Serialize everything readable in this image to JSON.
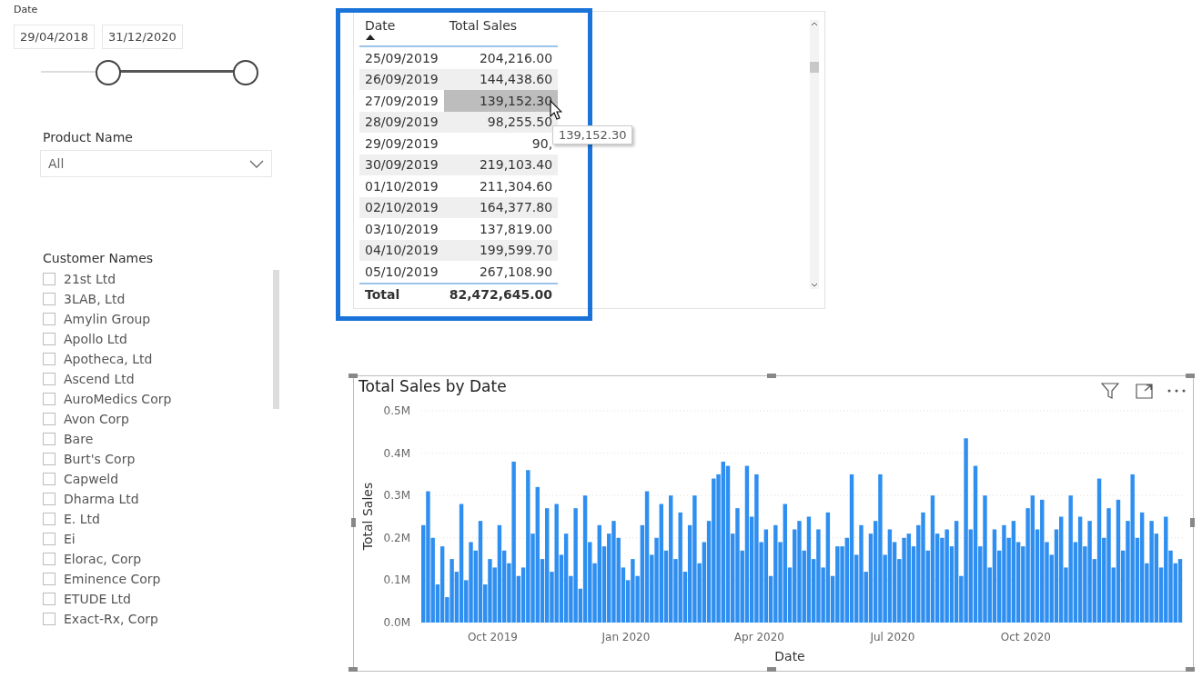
{
  "date_slicer": {
    "title": "Date",
    "start": "29/04/2018",
    "end": "31/12/2020",
    "thumbs": [
      {
        "level": 0.33
      },
      {
        "level": 1
      }
    ]
  },
  "product_slicer": {
    "title": "Product Name",
    "value": "All"
  },
  "customer_slicer": {
    "title": "Customer Names",
    "items": [
      {
        "label": "21st Ltd",
        "checked": false
      },
      {
        "label": "3LAB, Ltd",
        "checked": false
      },
      {
        "label": "Amylin Group",
        "checked": false
      },
      {
        "label": "Apollo Ltd",
        "checked": false
      },
      {
        "label": "Apotheca, Ltd",
        "checked": false
      },
      {
        "label": "Ascend Ltd",
        "checked": false
      },
      {
        "label": "AuroMedics Corp",
        "checked": false
      },
      {
        "label": "Avon Corp",
        "checked": false
      },
      {
        "label": "Bare",
        "checked": false
      },
      {
        "label": "Burt's Corp",
        "checked": false
      },
      {
        "label": "Capweld",
        "checked": false
      },
      {
        "label": "Dharma Ltd",
        "checked": false
      },
      {
        "label": "E. Ltd",
        "checked": false
      },
      {
        "label": "Ei",
        "checked": false
      },
      {
        "label": "Elorac, Corp",
        "checked": false
      },
      {
        "label": "Eminence Corp",
        "checked": false
      },
      {
        "label": "ETUDE Ltd",
        "checked": false
      },
      {
        "label": "Exact-Rx, Corp",
        "checked": false
      }
    ]
  },
  "table": {
    "columns": [
      "Date",
      "Total Sales"
    ],
    "rows": [
      {
        "date": "25/09/2019",
        "sales": "204,216.00",
        "selected": false
      },
      {
        "date": "26/09/2019",
        "sales": "144,438.60",
        "selected": false
      },
      {
        "date": "27/09/2019",
        "sales": "139,152.30",
        "selected": true
      },
      {
        "date": "28/09/2019",
        "sales": "98,255.50",
        "selected": false
      },
      {
        "date": "29/09/2019",
        "sales": "90,",
        "selected": false
      },
      {
        "date": "30/09/2019",
        "sales": "219,103.40",
        "selected": false
      },
      {
        "date": "01/10/2019",
        "sales": "211,304.60",
        "selected": false
      },
      {
        "date": "02/10/2019",
        "sales": "164,377.80",
        "selected": false
      },
      {
        "date": "03/10/2019",
        "sales": "137,819.00",
        "selected": false
      },
      {
        "date": "04/10/2019",
        "sales": "199,599.70",
        "selected": false
      },
      {
        "date": "05/10/2019",
        "sales": "267,108.90",
        "selected": false
      }
    ],
    "total_label": "Total",
    "total_value": "82,472,645.00",
    "tooltip": "139,152.30"
  },
  "chart": {
    "title": "Total Sales by Date",
    "chart_data": {
      "type": "bar",
      "grid": true,
      "xlabel": "Date",
      "ylabel": "Total Sales",
      "ylim": [
        0,
        500000
      ],
      "yticks": [
        {
          "value": 0,
          "label": "0.0M"
        },
        {
          "value": 100000,
          "label": "0.1M"
        },
        {
          "value": 200000,
          "label": "0.2M"
        },
        {
          "value": 300000,
          "label": "0.3M"
        },
        {
          "value": 400000,
          "label": "0.4M"
        },
        {
          "value": 500000,
          "label": "0.5M"
        }
      ],
      "categories": [
        null,
        null,
        null,
        null,
        null,
        null,
        null,
        null,
        null,
        null,
        null,
        null,
        null,
        null,
        null,
        "Oct 2019",
        null,
        null,
        null,
        null,
        null,
        null,
        null,
        null,
        null,
        null,
        null,
        null,
        null,
        null,
        null,
        null,
        null,
        null,
        null,
        null,
        null,
        null,
        null,
        null,
        null,
        null,
        null,
        "Jan 2020",
        null,
        null,
        null,
        null,
        null,
        null,
        null,
        null,
        null,
        null,
        null,
        null,
        null,
        null,
        null,
        null,
        null,
        null,
        null,
        null,
        null,
        null,
        null,
        null,
        null,
        null,
        null,
        "Apr 2020",
        null,
        null,
        null,
        null,
        null,
        null,
        null,
        null,
        null,
        null,
        null,
        null,
        null,
        null,
        null,
        null,
        null,
        null,
        null,
        null,
        null,
        null,
        null,
        null,
        null,
        null,
        null,
        "Jul 2020",
        null,
        null,
        null,
        null,
        null,
        null,
        null,
        null,
        null,
        null,
        null,
        null,
        null,
        null,
        null,
        null,
        null,
        null,
        null,
        null,
        null,
        null,
        null,
        null,
        null,
        null,
        null,
        "Oct 2020",
        null,
        null,
        null,
        null,
        null,
        null,
        null,
        null,
        null,
        null,
        null,
        null,
        null,
        null,
        null,
        null,
        null,
        null,
        null,
        null,
        null,
        null,
        null,
        null,
        null,
        null,
        null,
        null,
        null,
        null,
        null,
        null
      ],
      "series": [
        {
          "color": "#2f8ff0",
          "values": [
            230000,
            310000,
            200000,
            90000,
            180000,
            60000,
            150000,
            120000,
            280000,
            100000,
            190000,
            170000,
            240000,
            90000,
            150000,
            130000,
            230000,
            170000,
            140000,
            380000,
            110000,
            130000,
            360000,
            210000,
            320000,
            150000,
            270000,
            120000,
            280000,
            160000,
            210000,
            110000,
            270000,
            80000,
            300000,
            190000,
            140000,
            230000,
            180000,
            210000,
            240000,
            200000,
            130000,
            100000,
            150000,
            110000,
            230000,
            310000,
            160000,
            200000,
            280000,
            170000,
            300000,
            150000,
            260000,
            120000,
            230000,
            300000,
            140000,
            190000,
            240000,
            340000,
            350000,
            380000,
            370000,
            210000,
            270000,
            170000,
            370000,
            250000,
            350000,
            190000,
            220000,
            110000,
            230000,
            190000,
            280000,
            130000,
            220000,
            240000,
            170000,
            250000,
            150000,
            220000,
            130000,
            260000,
            110000,
            180000,
            180000,
            200000,
            350000,
            160000,
            230000,
            120000,
            210000,
            240000,
            350000,
            160000,
            220000,
            190000,
            150000,
            200000,
            210000,
            180000,
            230000,
            260000,
            170000,
            300000,
            210000,
            200000,
            220000,
            180000,
            240000,
            110000,
            435000,
            220000,
            370000,
            180000,
            300000,
            130000,
            220000,
            170000,
            230000,
            200000,
            240000,
            190000,
            180000,
            270000,
            300000,
            220000,
            290000,
            190000,
            160000,
            220000,
            250000,
            130000,
            300000,
            190000,
            250000,
            180000,
            240000,
            150000,
            340000,
            200000,
            270000,
            130000,
            290000,
            170000,
            240000,
            350000,
            200000,
            260000,
            140000,
            240000,
            210000,
            130000,
            250000,
            170000,
            140000,
            150000
          ]
        }
      ]
    }
  }
}
